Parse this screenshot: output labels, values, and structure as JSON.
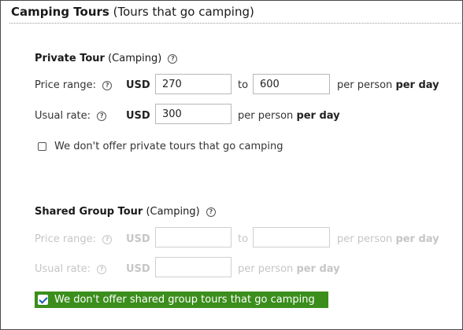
{
  "section": {
    "title_strong": "Camping Tours",
    "title_rest": "(Tours that go camping)"
  },
  "private_tour": {
    "title_strong": "Private Tour",
    "title_rest": "(Camping)",
    "price_range_label": "Price range:",
    "currency": "USD",
    "price_min": "270",
    "to_label": "to",
    "price_max": "600",
    "per_person": "per person",
    "per_day": "per day",
    "usual_rate_label": "Usual rate:",
    "usual_rate": "300",
    "checkbox_label": "We don't offer private tours that go camping",
    "checkbox_checked": false
  },
  "shared_tour": {
    "title_strong": "Shared Group Tour",
    "title_rest": "(Camping)",
    "price_range_label": "Price range:",
    "currency": "USD",
    "price_min": "",
    "to_label": "to",
    "price_max": "",
    "per_person": "per person",
    "per_day": "per day",
    "usual_rate_label": "Usual rate:",
    "usual_rate": "",
    "checkbox_label": "We don't offer shared group tours that go camping",
    "checkbox_checked": true
  },
  "help_glyph": "?",
  "colors": {
    "highlight": "#3b8e1c",
    "disabled_text": "#c6c6c6"
  }
}
